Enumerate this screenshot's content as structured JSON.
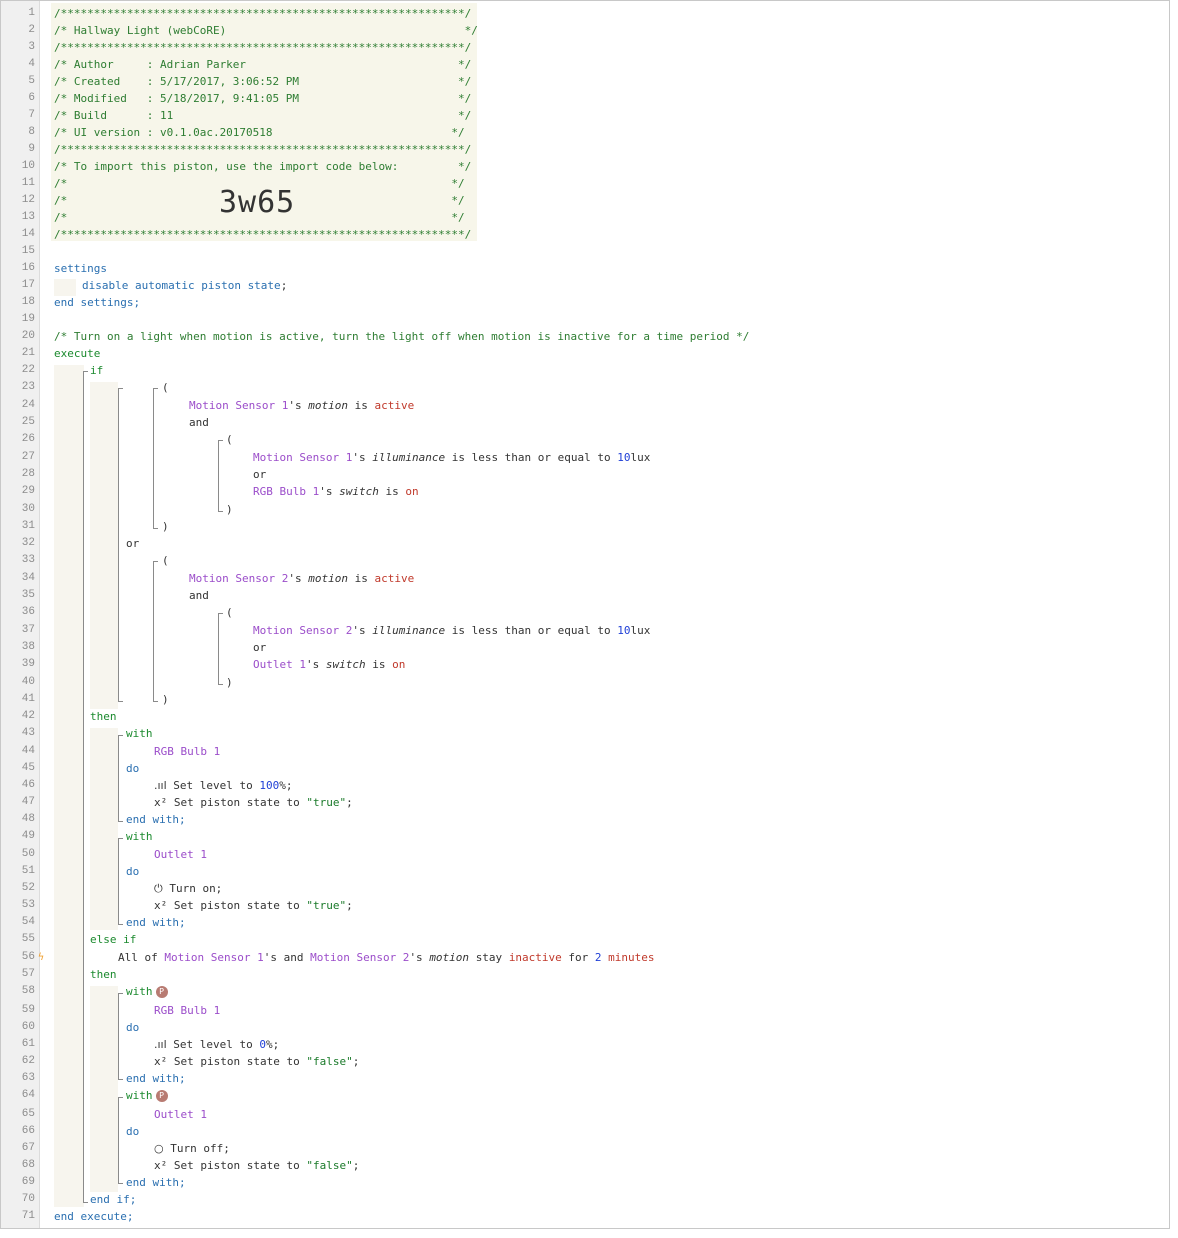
{
  "header": {
    "border": "/*************************************************************/",
    "title_line": "/* Hallway Light (webCoRE)                                    */",
    "author_line": "/* Author     : Adrian Parker                                */",
    "created_line": "/* Created    : 5/17/2017, 3:06:52 PM                        */",
    "modified_line": "/* Modified   : 5/18/2017, 9:41:05 PM                        */",
    "build_line": "/* Build      : 11                                           */",
    "ui_line": "/* UI version : v0.1.0ac.20170518                           */",
    "import_line": "/* To import this piston, use the import code below:         */",
    "empty_line": "/*                                                          */",
    "import_code": "3w65"
  },
  "code": {
    "settings": "settings",
    "disable": "disable automatic piston state;",
    "end_settings": "end settings;",
    "comment": "/* Turn on a light when motion is active, turn the light off when motion is inactive for a time period */",
    "execute": "execute",
    "if": "if",
    "open_paren": "(",
    "close_paren": ")",
    "and": "and",
    "or": "or",
    "then": "then",
    "with": "with",
    "do": "do",
    "end_with": "end with;",
    "else_if": "else if",
    "end_if": "end if;",
    "end_execute": "end execute;",
    "ms1": "Motion Sensor 1",
    "ms2": "Motion Sensor 2",
    "rgb": "RGB Bulb 1",
    "outlet": "Outlet 1",
    "poss": "'s",
    "motion": "motion",
    "illuminance": "illuminance",
    "switch": "switch",
    "is": "is",
    "active": "active",
    "inactive": "inactive",
    "on": "on",
    "lte": "is less than or equal to",
    "ten": "10",
    "lux": "lux",
    "set_level": "Set level to",
    "hundred": "100",
    "zero": "0",
    "pct": "%;",
    "set_state": "Set piston state to",
    "true_str": "\"true\"",
    "false_str": "\"false\"",
    "semi": ";",
    "turn_on": "Turn on;",
    "turn_off": "Turn off;",
    "all_of": "All of",
    "and_word": "and",
    "stay": "stay",
    "for": "for",
    "two": "2",
    "minutes": "minutes",
    "p_badge": "P",
    "x2": "x²"
  },
  "line_numbers": [
    "1",
    "2",
    "3",
    "4",
    "5",
    "6",
    "7",
    "8",
    "9",
    "10",
    "11",
    "12",
    "13",
    "14",
    "15",
    "16",
    "17",
    "18",
    "19",
    "20",
    "21",
    "22",
    "23",
    "24",
    "25",
    "26",
    "27",
    "28",
    "29",
    "30",
    "31",
    "32",
    "33",
    "34",
    "35",
    "36",
    "37",
    "38",
    "39",
    "40",
    "41",
    "42",
    "43",
    "44",
    "45",
    "46",
    "47",
    "48",
    "49",
    "50",
    "51",
    "52",
    "53",
    "54",
    "55",
    "56",
    "57",
    "58",
    "59",
    "60",
    "61",
    "62",
    "63",
    "64",
    "65",
    "66",
    "67",
    "68",
    "69",
    "70",
    "71"
  ]
}
